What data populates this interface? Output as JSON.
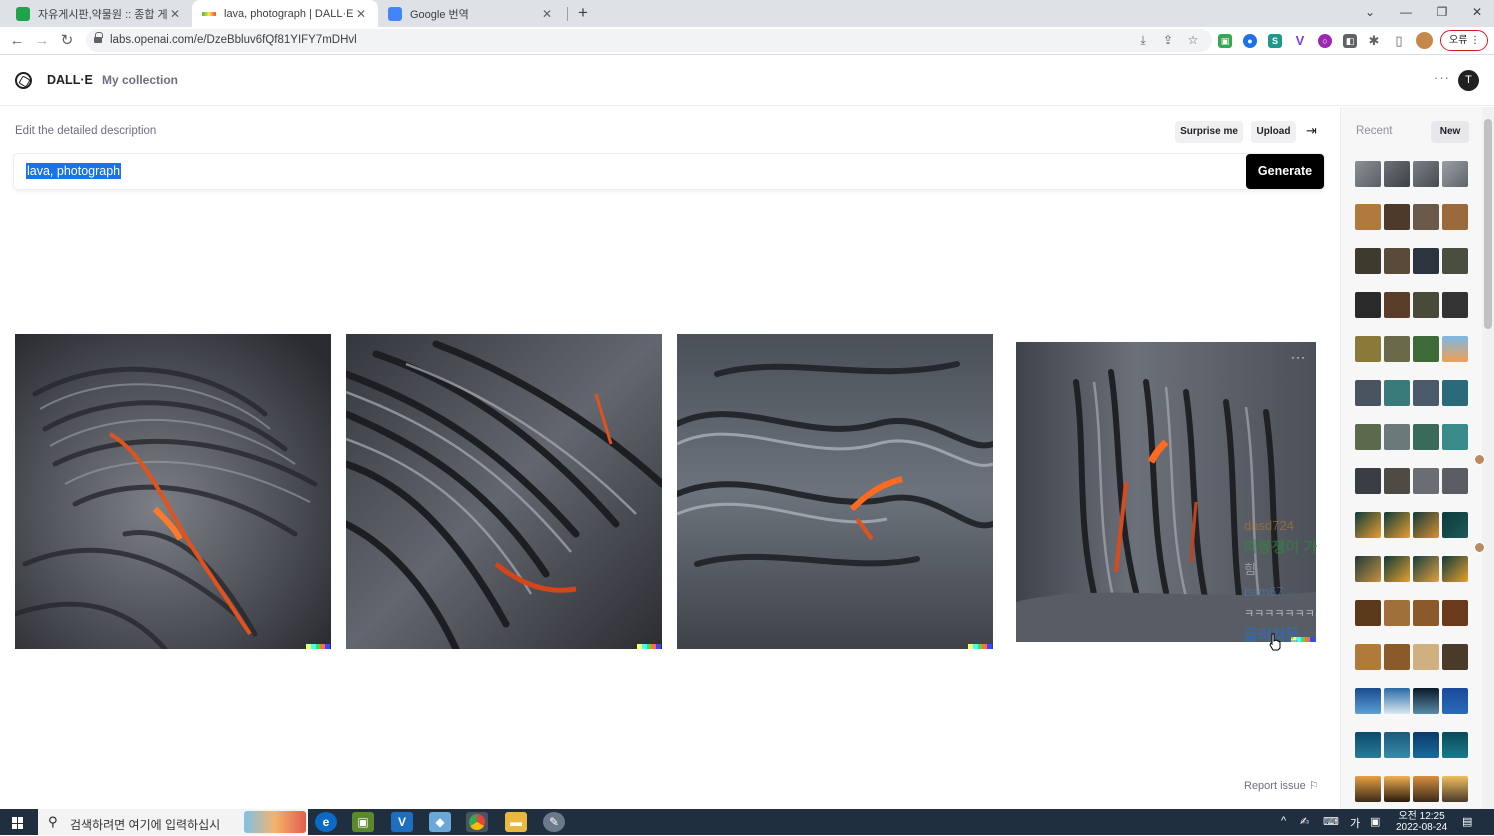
{
  "browser": {
    "tabs": [
      {
        "title": "자유게시판,약물원 :: 종합 게",
        "favicon_color": "#20a44b",
        "active": false
      },
      {
        "title": "lava, photograph | DALL·E",
        "favicon_color": "#4caf50",
        "active": true
      },
      {
        "title": "Google 번역",
        "favicon_color": "#4285f4",
        "active": false
      }
    ],
    "new_tab_glyph": "+",
    "url": "labs.openai.com/e/DzeBbluv6fQf81YIFY7mDHvl",
    "error_label": "오류",
    "user_initial_avatar": "T"
  },
  "app": {
    "brand": "DALL·E",
    "nav_collection": "My collection",
    "user_initial": "T",
    "description_label": "Edit the detailed description",
    "surprise_label": "Surprise me",
    "upload_label": "Upload",
    "prompt_value": "lava, photograph",
    "generate_label": "Generate",
    "report_label": "Report issue",
    "overlay_chat": [
      {
        "text": "dnsd724",
        "color": "#c77a2a"
      },
      {
        "text": "따봉쟁이 가",
        "color": "#2e8b3a"
      },
      {
        "text": "힘",
        "color": "#d0d0d0"
      },
      {
        "text": "bam67",
        "color": "#4a7fb5"
      },
      {
        "text": "ㅋㅋㅋㅋㅋㅋㅋㅋㅋ",
        "color": "#ffffff"
      },
      {
        "text": "골리쳐문",
        "color": "#1e73d8"
      },
      {
        "text": "ㅋㅋㅋㅋㅋㅋㅋㅋㅋ",
        "color": "#ffffff"
      }
    ]
  },
  "sidebar": {
    "recent_label": "Recent",
    "new_label": "New"
  },
  "taskbar": {
    "search_placeholder": "검색하려면 여기에 입력하십시",
    "clock_time": "오전 12:25",
    "clock_date": "2022-08-24",
    "ime_label": "가"
  },
  "colors": {
    "accent_black": "#000000",
    "selection_blue": "#1a73e8",
    "taskbar": "#1f2f3f"
  }
}
